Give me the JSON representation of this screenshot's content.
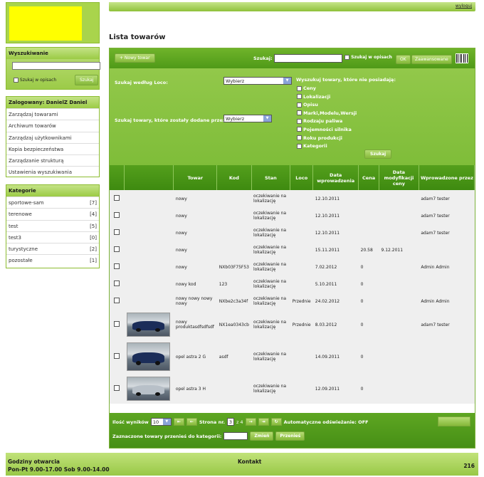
{
  "header": {
    "logout_label": "wyloguj"
  },
  "sidebar": {
    "search": {
      "title": "Wyszukiwanie",
      "checkbox_label": "Szukaj w opisach",
      "button_label": "Szukaj"
    },
    "user": {
      "title": "Zalogowany: DanielZ Daniel",
      "items": [
        "Zarządzaj towarami",
        "Archiwum towarów",
        "Zarządzaj użytkownikami",
        "Kopia bezpieczeństwa",
        "Zarządzanie strukturą",
        "Ustawienia wyszukiwania"
      ]
    },
    "categories": {
      "title": "Kategorie",
      "items": [
        {
          "name": "sportowe-sam",
          "count": "[7]"
        },
        {
          "name": "terenowe",
          "count": "[4]"
        },
        {
          "name": "test",
          "count": "[5]"
        },
        {
          "name": "test3",
          "count": "[0]"
        },
        {
          "name": "turystyczne",
          "count": "[2]"
        },
        {
          "name": "pozostałe",
          "count": "[1]"
        }
      ]
    }
  },
  "main": {
    "title": "Lista towarów",
    "toolbar": {
      "new_label": "+ Nowy towar",
      "search_label": "Szukaj:",
      "search_desc_label": "Szukaj w opisach",
      "ok_label": "OK",
      "advanced_label": "Zaawansowane"
    },
    "filter": {
      "loco_label": "Szukaj według Loco:",
      "loco_value": "Wybierz",
      "added_by_label": "Szukaj towary, które zostały dodane przez:",
      "added_by_value": "Wybierz",
      "missing_label": "Wyszukuj towary, które nie posiadają:",
      "missing_options": [
        "Ceny",
        "Lokalizacji",
        "Opisu",
        "Marki,Modelu,Wersji",
        "Rodzaju paliwa",
        "Pojemności silnika",
        "Roku produkcji",
        "Kategorii"
      ],
      "button_label": "Szukaj"
    },
    "table": {
      "headers": [
        "",
        "",
        "Towar",
        "Kod",
        "Stan",
        "Loco",
        "Data wprowadzenia",
        "Cena",
        "Data modyfikacji ceny",
        "Wprowadzone przez"
      ],
      "rows": [
        {
          "towar": "nowy",
          "kod": "",
          "stan": "oczekiwanie na lokalizację",
          "loco": "",
          "data": "12.10.2011",
          "cena": "",
          "data_mod": "",
          "przez": "adam7 tester",
          "img": ""
        },
        {
          "towar": "nowy",
          "kod": "",
          "stan": "oczekiwanie na lokalizację",
          "loco": "",
          "data": "12.10.2011",
          "cena": "",
          "data_mod": "",
          "przez": "adam7 tester",
          "img": ""
        },
        {
          "towar": "nowy",
          "kod": "",
          "stan": "oczekiwanie na lokalizację",
          "loco": "",
          "data": "12.10.2011",
          "cena": "",
          "data_mod": "",
          "przez": "adam7 tester",
          "img": ""
        },
        {
          "towar": "nowy",
          "kod": "",
          "stan": "oczekiwanie na lokalizację",
          "loco": "",
          "data": "15.11.2011",
          "cena": "20.58",
          "data_mod": "9.12.2011",
          "przez": "",
          "img": ""
        },
        {
          "towar": "nowy",
          "kod": "NXb03F75F53",
          "stan": "oczekiwanie na lokalizację",
          "loco": "",
          "data": "7.02.2012",
          "cena": "0",
          "data_mod": "",
          "przez": "Admin Admin",
          "img": ""
        },
        {
          "towar": "nowy kod",
          "kod": "123",
          "stan": "oczekiwanie na lokalizację",
          "loco": "",
          "data": "5.10.2011",
          "cena": "0",
          "data_mod": "",
          "przez": "",
          "img": ""
        },
        {
          "towar": "nowy nowy nowy nowy",
          "kod": "NXbe2c3a34f",
          "stan": "oczekiwanie na lokalizację",
          "loco": "Przednie",
          "data": "24.02.2012",
          "cena": "0",
          "data_mod": "",
          "przez": "Admin Admin",
          "img": ""
        },
        {
          "towar": "nowy produktasdfsdfsdf",
          "kod": "NX1ea0343cb",
          "stan": "oczekiwanie na lokalizację",
          "loco": "Przednie",
          "data": "8.03.2012",
          "cena": "0",
          "data_mod": "",
          "przez": "adam7 tester",
          "img": "car-front-photo"
        },
        {
          "towar": "opel astra 2 G",
          "kod": "asdf",
          "stan": "oczekiwanie na lokalizację",
          "loco": "",
          "data": "14.09.2011",
          "cena": "0",
          "data_mod": "",
          "przez": "",
          "img": "car-blue-photo"
        },
        {
          "towar": "opel astra 3 H",
          "kod": "",
          "stan": "oczekiwanie na lokalizację",
          "loco": "",
          "data": "12.09.2011",
          "cena": "0",
          "data_mod": "",
          "przez": "",
          "img": "car-silver-photo"
        }
      ]
    },
    "pager": {
      "results_label": "Ilość wyników",
      "results_value": "10",
      "page_label": "Strona nr.",
      "page_value": "3",
      "page_total": "z 4",
      "first": "⇤",
      "prev": "←",
      "next": "→",
      "last": "⇥",
      "refresh": "↻",
      "auto_refresh_label": "Automatyczne odświeżanie: OFF",
      "move_label": "Zaznaczone towary przenieś do kategorii:",
      "change_label": "Zmień",
      "move_button": "Przenieś"
    }
  },
  "footer": {
    "hours_title": "Godziny otwarcia",
    "hours_text": "Pon-Pt 9.00-17.00 Sob 9.00-14.00",
    "contact": "Kontakt",
    "number": "216"
  }
}
